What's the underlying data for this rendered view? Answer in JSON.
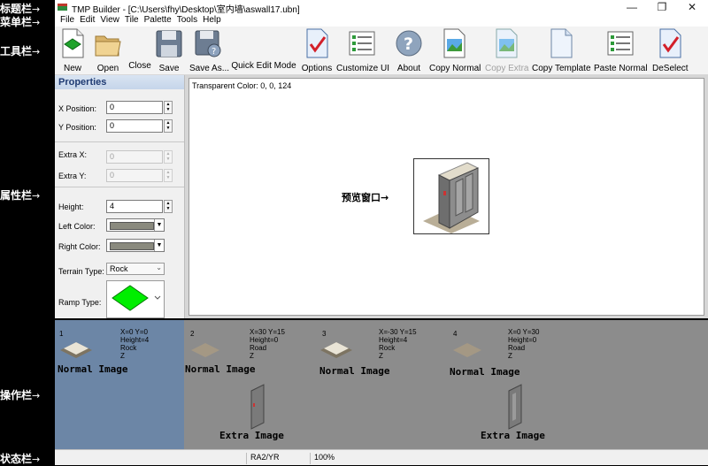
{
  "annotations": {
    "title_bar": "标题栏",
    "menu_bar": "菜单栏",
    "toolbar": "工具栏",
    "properties": "属性栏",
    "operations": "操作栏",
    "status_bar": "状态栏",
    "preview": "预览窗口"
  },
  "window": {
    "title": "TMP Builder - [C:\\Users\\fhy\\Desktop\\室内墙\\aswall17.ubn]",
    "minimize": "—",
    "restore": "❐",
    "close": "✕"
  },
  "menu": [
    "File",
    "Edit",
    "View",
    "Tile",
    "Palette",
    "Tools",
    "Help"
  ],
  "toolbar": {
    "new": "New",
    "open": "Open",
    "close": "Close",
    "save": "Save",
    "save_as": "Save As...",
    "quick_edit": "Quick Edit Mode",
    "options": "Options",
    "customize": "Customize UI",
    "about": "About",
    "copy_normal": "Copy Normal",
    "copy_extra": "Copy Extra",
    "copy_template": "Copy Template",
    "paste_normal": "Paste Normal",
    "deselect": "DeSelect"
  },
  "properties": {
    "header": "Properties",
    "x_label": "X Position:",
    "x_value": "0",
    "y_label": "Y Position:",
    "y_value": "0",
    "extra_x_label": "Extra X:",
    "extra_x_value": "0",
    "extra_y_label": "Extra Y:",
    "extra_y_value": "0",
    "height_label": "Height:",
    "height_value": "4",
    "left_color_label": "Left Color:",
    "right_color_label": "Right Color:",
    "terrain_label": "Terrain Type:",
    "terrain_value": "Rock",
    "ramp_label": "Ramp Type:"
  },
  "preview": {
    "transparent_color": "Transparent Color: 0, 0, 124"
  },
  "tiles": [
    {
      "num": "1",
      "info": [
        "X=0 Y=0",
        "Height=4",
        "Rock",
        "Z"
      ],
      "normal": "Normal Image"
    },
    {
      "num": "2",
      "info": [
        "X=30 Y=15",
        "Height=0",
        "Road",
        "Z"
      ],
      "normal": "Normal Image",
      "extra": "Extra Image"
    },
    {
      "num": "3",
      "info": [
        "X=-30 Y=15",
        "Height=4",
        "Rock",
        "Z"
      ],
      "normal": "Normal Image"
    },
    {
      "num": "4",
      "info": [
        "X=0 Y=30",
        "Height=0",
        "Road",
        "Z"
      ],
      "normal": "Normal Image",
      "extra": "Extra Image"
    }
  ],
  "status": {
    "game": "RA2/YR",
    "zoom": "100%"
  }
}
